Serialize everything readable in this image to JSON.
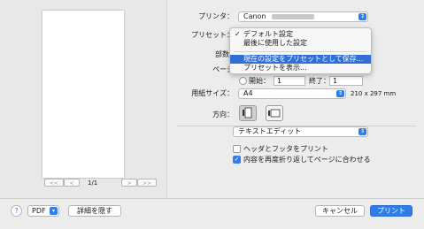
{
  "preview": {
    "page_count": "1/1",
    "nav_first": "<<",
    "nav_prev": "<",
    "nav_next": ">",
    "nav_last": ">>"
  },
  "printer": {
    "label": "プリンタ：",
    "value": "Canon"
  },
  "preset": {
    "label": "プリセット：",
    "menu": [
      {
        "label": "デフォルト設定",
        "checked": true
      },
      {
        "label": "最後に使用した設定"
      },
      {
        "label": "現在の設定をプリセットとして保存...",
        "selected": true
      },
      {
        "label": "プリセットを表示..."
      }
    ]
  },
  "copies": {
    "label": "部数"
  },
  "pages": {
    "label": "ページ",
    "from_label": "開始：",
    "from_value": "1",
    "to_label": "終了：",
    "to_value": "1"
  },
  "paper_size": {
    "label": "用紙サイズ：",
    "value": "A4",
    "dimensions": "210 x 297 mm"
  },
  "orientation": {
    "label": "方向：",
    "portrait_icon": "portrait-orientation-icon",
    "landscape_icon": "landscape-orientation-icon"
  },
  "app_section": {
    "value": "テキストエディット"
  },
  "options": {
    "header_footer": {
      "label": "ヘッダとフッタをプリント",
      "checked": false
    },
    "rewrap": {
      "label": "内容を再度折り返してページに合わせる",
      "checked": true
    }
  },
  "bottom": {
    "help": "?",
    "pdf": "PDF",
    "hide_details": "詳細を隠す",
    "cancel": "キャンセル",
    "print": "プリント"
  },
  "colors": {
    "accent": "#2f7de9",
    "menu_highlight": "#2f6fd6"
  }
}
